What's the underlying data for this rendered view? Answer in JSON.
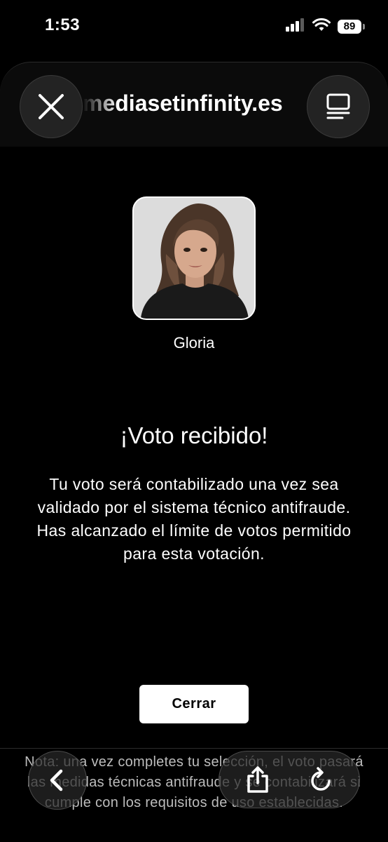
{
  "status_bar": {
    "time": "1:53",
    "battery": "89"
  },
  "browser": {
    "url": "mediasetinfinity.es"
  },
  "candidate": {
    "name": "Gloria"
  },
  "result": {
    "title": "¡Voto recibido!",
    "message": "Tu voto será contabilizado una vez sea validado por el sistema técnico antifraude. Has alcanzado el límite de votos permitido para esta votación.",
    "close_label": "Cerrar"
  },
  "bottom": {
    "note": "Nota: una vez completes tu selección, el voto pasará las medidas técnicas antifraude y se contabilizará si cumple con los requisitos de uso establecidas."
  },
  "icons": {
    "close": "close-icon",
    "tabs": "reader-icon",
    "back": "chevron-left-icon",
    "share": "share-icon",
    "reload": "reload-icon"
  }
}
